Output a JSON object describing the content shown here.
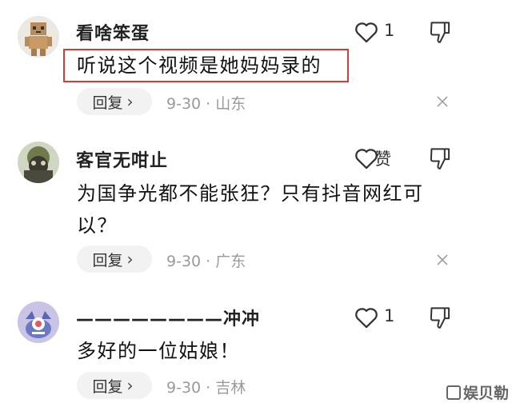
{
  "comments": [
    {
      "username": "看啥笨蛋",
      "like_label": "1",
      "content": "听说这个视频是她妈妈录的",
      "reply_label": "回复",
      "date": "9-30",
      "location": "山东"
    },
    {
      "username": "客官无咁止",
      "like_label": "赞",
      "content": "为国争光都不能张狂？只有抖音网红可以？",
      "reply_label": "回复",
      "date": "9-30",
      "location": "广东"
    },
    {
      "username": "————————冲冲",
      "like_label": "1",
      "content": "多好的一位姑娘！",
      "reply_label": "回复",
      "date": "9-30",
      "location": "吉林"
    }
  ],
  "meta_separator": "·",
  "reply_chevron": "›",
  "icons": {
    "like": "heart-outline-icon",
    "dislike": "thumbs-down-icon",
    "close": "close-x-icon"
  },
  "colors": {
    "highlight_border": "#d93a36",
    "reply_bg": "#f2f2f2",
    "meta_text": "#9a9a9a"
  },
  "watermark": "娱贝勒"
}
